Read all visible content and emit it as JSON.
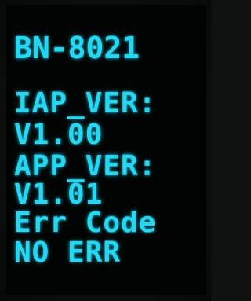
{
  "display": {
    "model": "BN-8021",
    "iap_label": "IAP_VER:",
    "iap_version": "V1.00",
    "app_label": "APP_VER:",
    "app_version": "V1.01",
    "err_label": "Err Code",
    "err_value": "NO ERR"
  },
  "colors": {
    "text": "#25d7f2",
    "background": "#020403"
  }
}
